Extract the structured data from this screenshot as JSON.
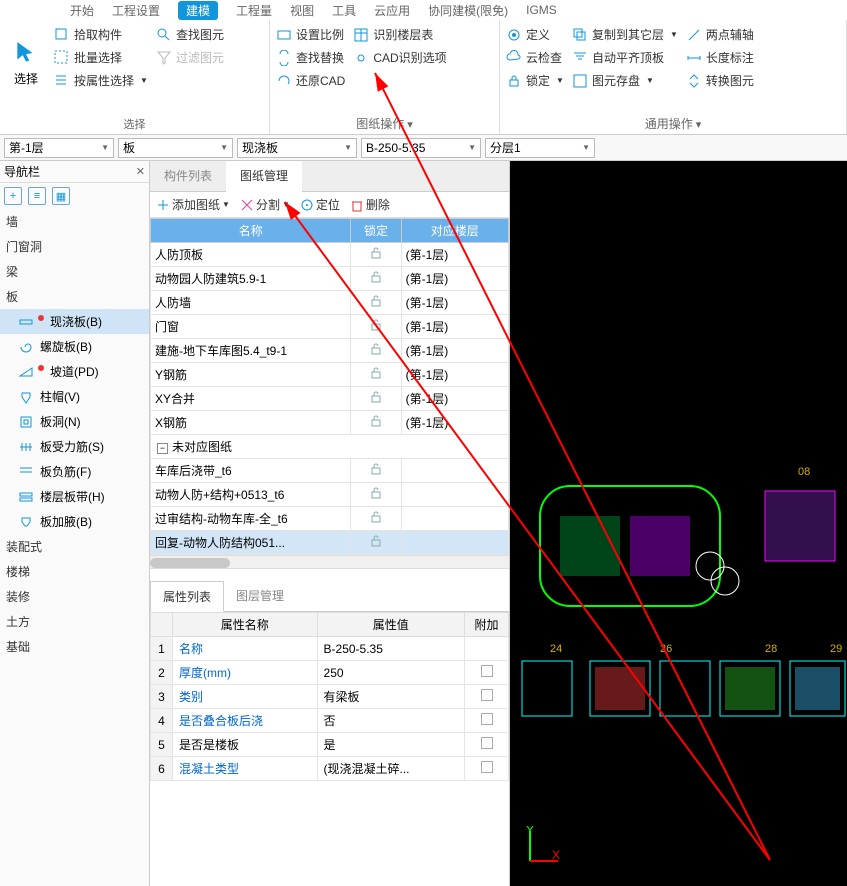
{
  "ribbon_tabs": [
    "开始",
    "工程设置",
    "建模",
    "工程量",
    "视图",
    "工具",
    "云应用",
    "协同建模(限免)",
    "IGMS"
  ],
  "ribbon_tabs_active": 2,
  "select_group": {
    "label": "选择",
    "big": "选择",
    "items": [
      "拾取构件",
      "批量选择",
      "按属性选择"
    ],
    "items2": [
      "查找图元",
      "过滤图元"
    ]
  },
  "paper_group": {
    "label": "图纸操作",
    "items_a": [
      "设置比例",
      "查找替换",
      "还原CAD"
    ],
    "items_b": [
      "识别楼层表",
      "CAD识别选项"
    ]
  },
  "common_group": {
    "label": "通用操作",
    "items_a": [
      "定义",
      "云检查",
      "锁定"
    ],
    "items_b": [
      "复制到其它层",
      "自动平齐顶板",
      "图元存盘"
    ],
    "items_c": [
      "两点辅轴",
      "长度标注",
      "转换图元"
    ]
  },
  "dd_floor": "第-1层",
  "dd_cat": "板",
  "dd_type": "现浇板",
  "dd_name": "B-250-5.35",
  "dd_layer": "分层1",
  "nav_title": "导航栏",
  "nav_cats": [
    "墙",
    "门窗洞",
    "梁",
    "板"
  ],
  "nav_leaves": [
    {
      "label": "现浇板(B)",
      "sel": true,
      "dot": true,
      "icon": "slab"
    },
    {
      "label": "螺旋板(B)",
      "icon": "spiral"
    },
    {
      "label": "坡道(PD)",
      "dot": true,
      "icon": "ramp"
    },
    {
      "label": "柱帽(V)",
      "icon": "cap"
    },
    {
      "label": "板洞(N)",
      "icon": "hole"
    },
    {
      "label": "板受力筋(S)",
      "icon": "rebar"
    },
    {
      "label": "板负筋(F)",
      "icon": "negrebar"
    },
    {
      "label": "楼层板带(H)",
      "icon": "strip"
    },
    {
      "label": "板加腋(B)",
      "icon": "haunch"
    }
  ],
  "nav_more": [
    "装配式",
    "楼梯",
    "装修",
    "土方",
    "基础"
  ],
  "mid_tabs": [
    "构件列表",
    "图纸管理"
  ],
  "mid_tab_active": 1,
  "toolbar": {
    "add": "添加图纸",
    "split": "分割",
    "locate": "定位",
    "delete": "删除"
  },
  "table_head": {
    "name": "名称",
    "lock": "锁定",
    "floor": "对应楼层"
  },
  "drawings": [
    {
      "name": "人防顶板",
      "floor": "(第-1层)"
    },
    {
      "name": "动物园人防建筑5.9-1",
      "floor": "(第-1层)"
    },
    {
      "name": "人防墙",
      "floor": "(第-1层)"
    },
    {
      "name": "门窗",
      "floor": "(第-1层)"
    },
    {
      "name": "建施-地下车库图5.4_t9-1",
      "floor": "(第-1层)"
    },
    {
      "name": "Y钢筋",
      "floor": "(第-1层)"
    },
    {
      "name": "XY合并",
      "floor": "(第-1层)"
    },
    {
      "name": "X钢筋",
      "floor": "(第-1层)"
    }
  ],
  "group2": "未对应图纸",
  "drawings2": [
    {
      "name": "车库后浇带_t6"
    },
    {
      "name": "动物人防+结构+0513_t6"
    },
    {
      "name": "过审结构-动物车库-全_t6"
    },
    {
      "name": "回复-动物人防结构051...",
      "sel": true
    }
  ],
  "prop_tabs": [
    "属性列表",
    "图层管理"
  ],
  "prop_tab_active": 0,
  "prop_head": {
    "name": "属性名称",
    "value": "属性值",
    "extra": "附加"
  },
  "props": [
    {
      "n": "名称",
      "v": "B-250-5.35",
      "link": true
    },
    {
      "n": "厚度(mm)",
      "v": "250",
      "link": true,
      "chk": true
    },
    {
      "n": "类别",
      "v": "有梁板",
      "link": true,
      "chk": true
    },
    {
      "n": "是否叠合板后浇",
      "v": "否",
      "link": true,
      "chk": true
    },
    {
      "n": "是否是楼板",
      "v": "是",
      "chk": true
    },
    {
      "n": "混凝土类型",
      "v": "(现浇混凝土碎...",
      "link": true,
      "chk": true
    }
  ],
  "vp_labels": [
    "08",
    "24",
    "26",
    "28",
    "29"
  ],
  "axis": {
    "x": "X",
    "y": "Y"
  }
}
